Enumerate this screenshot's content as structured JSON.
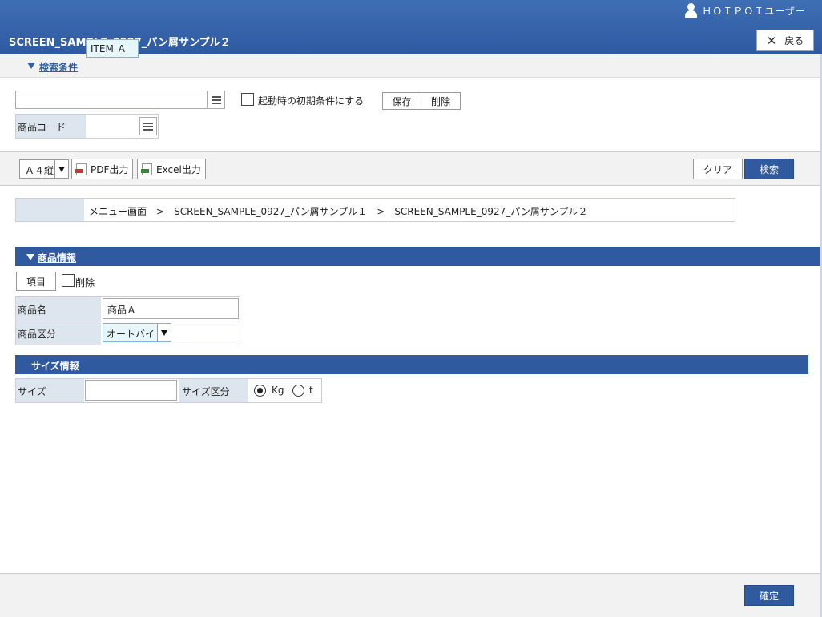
{
  "header": {
    "user_name": "ＨＯＩＰＯＩユーザー",
    "title": "SCREEN_SAMPLE_0927_パン屑サンプル２",
    "back_label": "戻る"
  },
  "search": {
    "section_label": "検索条件",
    "condition_value": "",
    "initial_condition_label": "起動時の初期条件にする",
    "save_label": "保存",
    "delete_label": "削除",
    "product_code_label": "商品コード",
    "product_code_value": "ITEM_A"
  },
  "toolbar": {
    "paper_size": "Ａ４縦",
    "pdf_label": "PDF出力",
    "excel_label": "Excel出力",
    "clear_label": "クリア",
    "search_label": "検索"
  },
  "breadcrumb": {
    "items": [
      "メニュー画面",
      "SCREEN_SAMPLE_0927_パン屑サンプル１",
      "SCREEN_SAMPLE_0927_パン屑サンプル２"
    ],
    "separator": ">"
  },
  "product_section": {
    "label": "商品情報",
    "item_button": "項目",
    "delete_check_label": "削除",
    "name_label": "商品名",
    "name_value": "商品Ａ",
    "kubun_label": "商品区分",
    "kubun_value": "オートバイ"
  },
  "size_section": {
    "label": "サイズ情報",
    "size_label": "サイズ",
    "size_value": "",
    "size_kubun_label": "サイズ区分",
    "options": [
      "Kg",
      "t"
    ],
    "selected": "Kg"
  },
  "footer": {
    "confirm_label": "確定"
  },
  "colors": {
    "header_blue": "#2e5aa0",
    "label_bg": "#dde5ee",
    "highlight_input": "#e6f6fb"
  }
}
